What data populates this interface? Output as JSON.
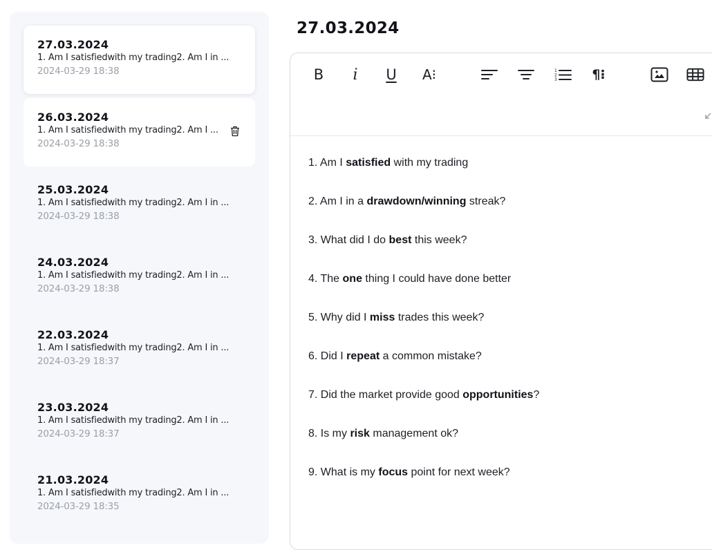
{
  "sidebar": {
    "entries": [
      {
        "date": "27.03.2024",
        "preview": "1. Am I satisfiedwith my trading2. Am I in ...",
        "time": "2024-03-29 18:38"
      },
      {
        "date": "26.03.2024",
        "preview": "1. Am I satisfiedwith my trading2. Am I ...",
        "time": "2024-03-29 18:38"
      },
      {
        "date": "25.03.2024",
        "preview": "1. Am I satisfiedwith my trading2. Am I in ...",
        "time": "2024-03-29 18:38"
      },
      {
        "date": "24.03.2024",
        "preview": "1. Am I satisfiedwith my trading2. Am I in ...",
        "time": "2024-03-29 18:38"
      },
      {
        "date": "22.03.2024",
        "preview": "1. Am I satisfiedwith my trading2. Am I in ...",
        "time": "2024-03-29 18:37"
      },
      {
        "date": "23.03.2024",
        "preview": "1. Am I satisfiedwith my trading2. Am I in ...",
        "time": "2024-03-29 18:37"
      },
      {
        "date": "21.03.2024",
        "preview": "1. Am I satisfiedwith my trading2. Am I in ...",
        "time": "2024-03-29 18:35"
      }
    ]
  },
  "editor": {
    "title": "27.03.2024",
    "toolbar": {
      "bold": "B",
      "italic": "i",
      "underline": "U",
      "font_size": "A⁝",
      "paragraph": "¶⁝",
      "icons": [
        "bold-icon",
        "italic-icon",
        "underline-icon",
        "font-size-icon",
        "align-left-icon",
        "align-center-icon",
        "numbered-list-icon",
        "paragraph-format-icon",
        "insert-image-icon",
        "insert-table-icon"
      ]
    },
    "questions": [
      {
        "pre": "1. Am I ",
        "bold": "satisfied",
        "post": " with my trading"
      },
      {
        "pre": "2. Am I in a ",
        "bold": "drawdown/winning",
        "post": " streak?"
      },
      {
        "pre": "3. What did I do ",
        "bold": "best",
        "post": " this week?"
      },
      {
        "pre": "4. The ",
        "bold": "one",
        "post": " thing I could have done better"
      },
      {
        "pre": "5. Why did I ",
        "bold": "miss",
        "post": " trades this week?"
      },
      {
        "pre": "6. Did I ",
        "bold": "repeat",
        "post": " a common mistake?"
      },
      {
        "pre": "7. Did the market provide good ",
        "bold": "opportunities",
        "post": "?"
      },
      {
        "pre": "8. Is my ",
        "bold": "risk",
        "post": " management ok?"
      },
      {
        "pre": "9. What is my ",
        "bold": "focus",
        "post": " point for next week?"
      }
    ]
  },
  "colors": {
    "sidebar_bg": "#f6f7fb",
    "text": "#111318",
    "muted": "#9aa0a8",
    "border": "#d9dbe0"
  }
}
